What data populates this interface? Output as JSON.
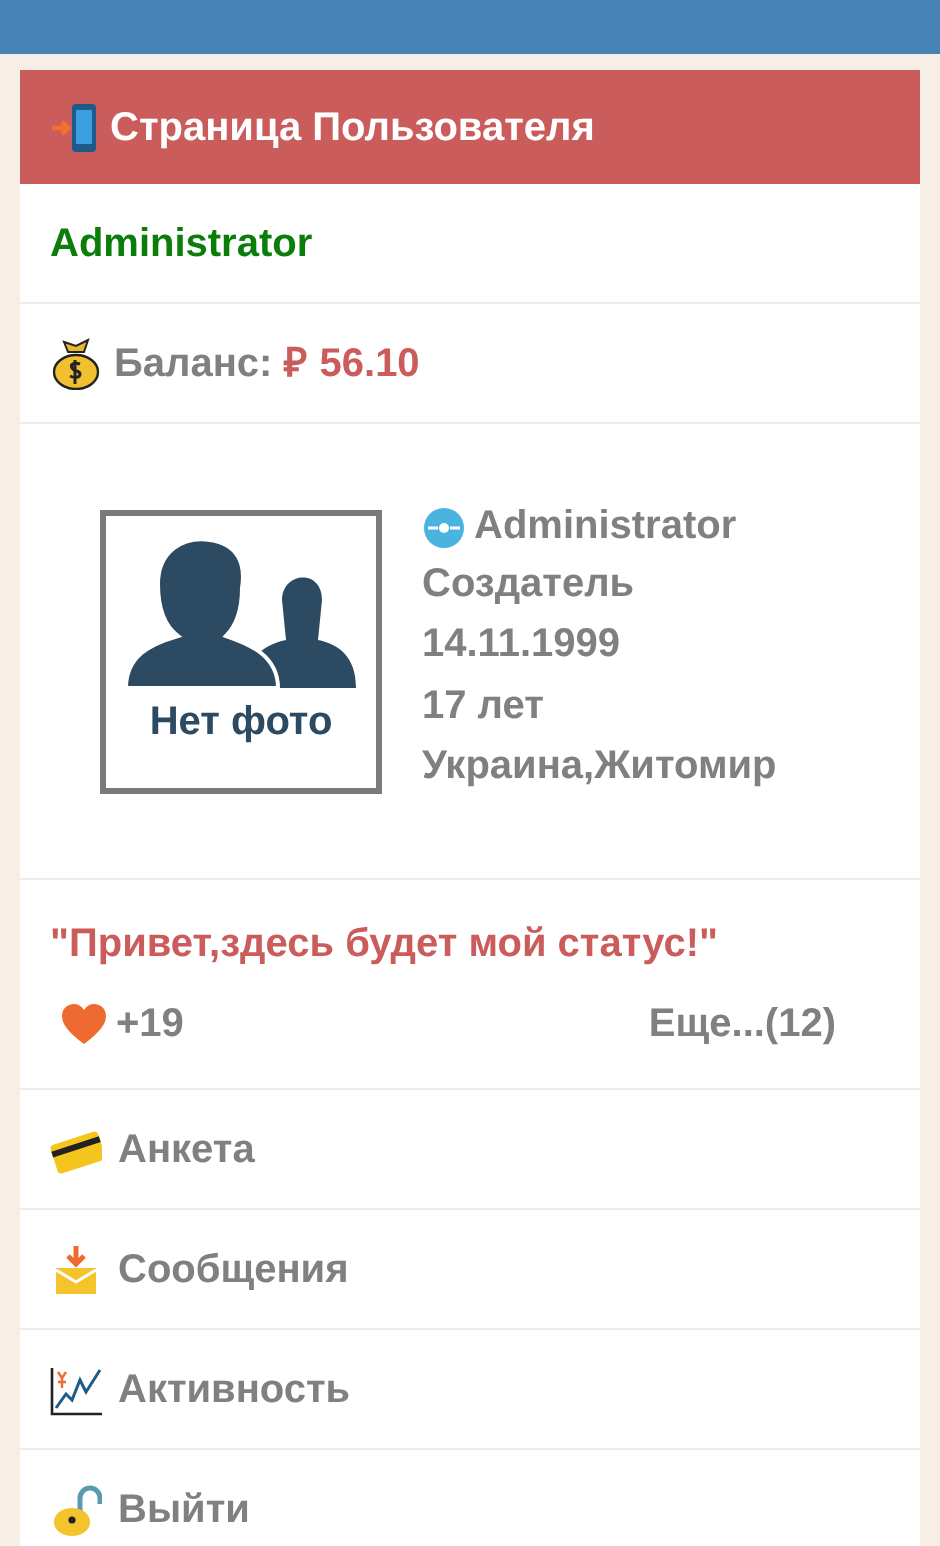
{
  "header": {
    "title": "Страница Пользователя"
  },
  "username": "Administrator",
  "balance": {
    "label": "Баланс:",
    "amount": "₽ 56.10"
  },
  "profile": {
    "photo_label": "Нет фото",
    "name": "Administrator",
    "role": "Создатель",
    "birthdate": "14.11.1999",
    "age": "17 лет",
    "location": "Украина,Житомир"
  },
  "status": "\"Привет,здесь будет мой статус!\"",
  "likes": {
    "count": "+19",
    "more": "Еще...(12)"
  },
  "menu": [
    {
      "kind": "card",
      "label": "Анкета"
    },
    {
      "kind": "mail",
      "label": "Сообщения"
    },
    {
      "kind": "chart",
      "label": "Активность"
    },
    {
      "kind": "lock",
      "label": "Выйти"
    }
  ]
}
